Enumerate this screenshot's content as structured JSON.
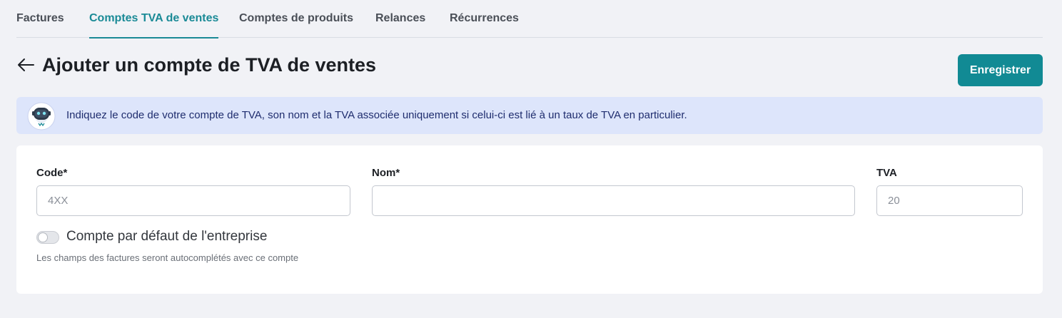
{
  "tabs": [
    {
      "label": "Factures",
      "active": false
    },
    {
      "label": "Comptes TVA de ventes",
      "active": true
    },
    {
      "label": "Comptes de produits",
      "active": false
    },
    {
      "label": "Relances",
      "active": false
    },
    {
      "label": "Récurrences",
      "active": false
    }
  ],
  "header": {
    "back_icon": "arrow-left-icon",
    "title": "Ajouter un compte de TVA de ventes",
    "save_label": "Enregistrer"
  },
  "banner": {
    "icon": "robot-assistant-icon",
    "text": "Indiquez le code de votre compte de TVA, son nom et la TVA associée uniquement si celui-ci est lié à un taux de TVA en particulier."
  },
  "form": {
    "code": {
      "label": "Code*",
      "value": "",
      "placeholder": "4XX"
    },
    "nom": {
      "label": "Nom*",
      "value": "",
      "placeholder": ""
    },
    "tva": {
      "label": "TVA",
      "value": "",
      "placeholder": "20"
    },
    "default_toggle": {
      "label": "Compte par défaut de l'entreprise",
      "checked": false,
      "help": "Les champs des factures seront autocomplétés avec ce compte"
    }
  },
  "colors": {
    "accent": "#118a94",
    "background": "#f1f2f6",
    "banner_bg": "#dde5fb",
    "banner_text": "#1f2d6e"
  }
}
